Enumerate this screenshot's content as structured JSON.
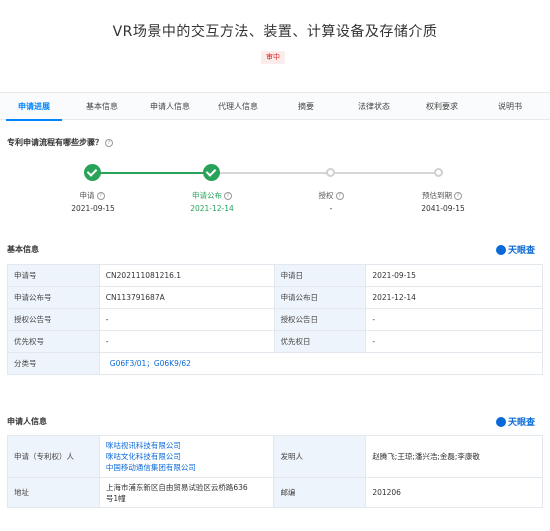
{
  "title": "VR场景中的交互方法、装置、计算设备及存储介质",
  "status_badge": "审中",
  "tabs": [
    "申请进展",
    "基本信息",
    "申请人信息",
    "代理人信息",
    "摘要",
    "法律状态",
    "权利要求",
    "说明书"
  ],
  "progress": {
    "heading": "专利申请流程有哪些步骤？",
    "steps": [
      {
        "label": "申请",
        "date": "2021-09-15",
        "state": "done"
      },
      {
        "label": "申请公布",
        "date": "2021-12-14",
        "state": "done"
      },
      {
        "label": "授权",
        "date": "-",
        "state": "todo"
      },
      {
        "label": "预估到期",
        "date": "2041-09-15",
        "state": "todo"
      }
    ]
  },
  "brand": "天眼查",
  "basic": {
    "heading": "基本信息",
    "rows": [
      {
        "k1": "申请号",
        "v1": "CN202111081216.1",
        "k2": "申请日",
        "v2": "2021-09-15"
      },
      {
        "k1": "申请公布号",
        "v1": "CN113791687A",
        "k2": "申请公布日",
        "v2": "2021-12-14"
      },
      {
        "k1": "授权公告号",
        "v1": "-",
        "k2": "授权公告日",
        "v2": "-"
      },
      {
        "k1": "优先权号",
        "v1": "-",
        "k2": "优先权日",
        "v2": "-"
      }
    ],
    "class_label": "分类号",
    "classes": [
      "G06F3/01",
      "G06K9/62"
    ],
    "class_sep": "；"
  },
  "applicant": {
    "heading": "申请人信息",
    "applicant_label": "申请（专利权）人",
    "applicants": [
      "咪咕视讯科技有限公司",
      "咪咕文化科技有限公司",
      "中国移动通信集团有限公司"
    ],
    "inventor_label": "发明人",
    "inventors": "赵腾飞;王琼;潘兴浩;金磊;李康敬",
    "address_label": "地址",
    "address_line1": "上海市浦东新区自由贸易试验区云桥路636",
    "address_line2": "号1幢",
    "zip_label": "邮编",
    "zip": "201206"
  }
}
